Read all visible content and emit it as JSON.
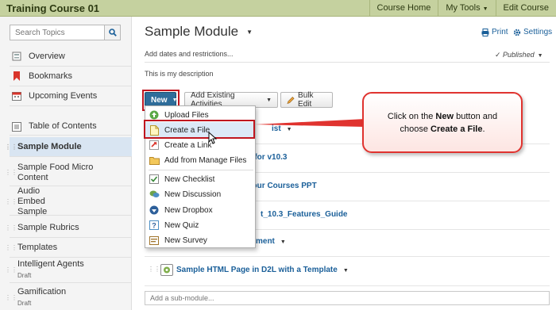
{
  "topbar": {
    "course_title": "Training Course 01",
    "nav": [
      "Course Home",
      "My Tools",
      "Edit Course"
    ]
  },
  "sidebar": {
    "search_placeholder": "Search Topics",
    "top_items": [
      {
        "label": "Overview",
        "icon": "overview-icon"
      },
      {
        "label": "Bookmarks",
        "icon": "bookmark-icon"
      },
      {
        "label": "Upcoming Events",
        "icon": "calendar-icon"
      }
    ],
    "toc_label": "Table of Contents",
    "modules": [
      {
        "label": "Sample Module",
        "sub": ""
      },
      {
        "label": "Sample Food Micro Content",
        "sub": ""
      },
      {
        "label": "Audio Embed Sample",
        "sub": ""
      },
      {
        "label": "Sample Rubrics",
        "sub": ""
      },
      {
        "label": "Templates",
        "sub": ""
      },
      {
        "label": "Intelligent Agents",
        "sub": "Draft"
      },
      {
        "label": "Gamification",
        "sub": "Draft"
      }
    ]
  },
  "main": {
    "module_title": "Sample Module",
    "print_label": "Print",
    "settings_label": "Settings",
    "add_dates": "Add dates and restrictions...",
    "status": "Published",
    "description": "This is my description",
    "buttons": {
      "new": "New",
      "add_existing": "Add Existing Activities",
      "bulk_edit": "Bulk Edit"
    },
    "content_rows": [
      "ist",
      "s for v10.3",
      "your Courses PPT",
      "t_10.3_Features_Guide",
      "ment",
      "Sample HTML Page in D2L with a Template"
    ],
    "sub_module_placeholder": "Add a sub-module..."
  },
  "new_menu": {
    "items": [
      {
        "label": "Upload Files",
        "icon": "upload-icon"
      },
      {
        "label": "Create a File",
        "icon": "file-icon"
      },
      {
        "label": "Create a Link",
        "icon": "link-icon"
      },
      {
        "label": "Add from Manage Files",
        "icon": "folder-icon"
      },
      {
        "label": "New Checklist",
        "icon": "checklist-icon"
      },
      {
        "label": "New Discussion",
        "icon": "discussion-icon"
      },
      {
        "label": "New Dropbox",
        "icon": "dropbox-icon"
      },
      {
        "label": "New Quiz",
        "icon": "quiz-icon"
      },
      {
        "label": "New Survey",
        "icon": "survey-icon"
      }
    ]
  },
  "callout": {
    "pre": "Click on the ",
    "bold1": "New",
    "mid": " button and choose ",
    "bold2": "Create a File",
    "post": "."
  },
  "colors": {
    "topbar": "#c5d19f",
    "primary_button": "#2f6d9a",
    "highlight": "#c0161f",
    "link": "#1a5f99"
  }
}
